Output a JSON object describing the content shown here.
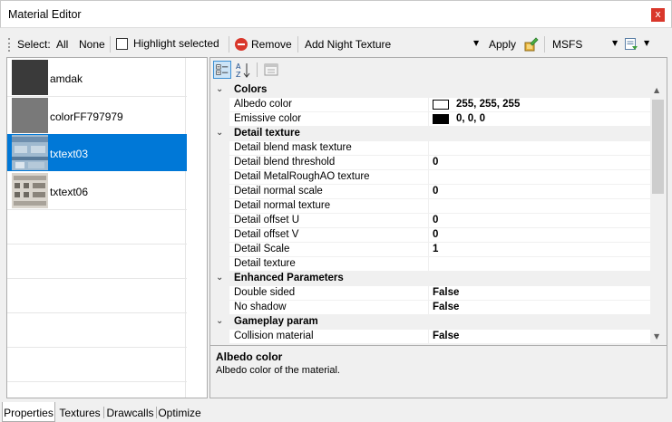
{
  "window": {
    "title": "Material Editor",
    "close_glyph": "x"
  },
  "toolbar": {
    "select_label": "Select:",
    "all_label": "All",
    "none_label": "None",
    "highlight_label": "Highlight selected",
    "highlight_checked": false,
    "remove_label": "Remove",
    "add_night_texture": "Add Night Texture",
    "apply_label": "Apply",
    "platform_value": "MSFS"
  },
  "materials": [
    {
      "name": "amdak",
      "selected": false
    },
    {
      "name": "colorFF797979",
      "selected": false
    },
    {
      "name": "txtext03",
      "selected": true
    },
    {
      "name": "txtext06",
      "selected": false
    }
  ],
  "properties": {
    "categories": [
      {
        "name": "Colors",
        "rows": [
          {
            "name": "Albedo color",
            "value": "255, 255, 255",
            "swatch": "#ffffff"
          },
          {
            "name": "Emissive color",
            "value": "0, 0, 0",
            "swatch": "#000000"
          }
        ]
      },
      {
        "name": "Detail texture",
        "rows": [
          {
            "name": "Detail blend mask texture",
            "value": ""
          },
          {
            "name": "Detail blend threshold",
            "value": "0"
          },
          {
            "name": "Detail MetalRoughAO texture",
            "value": ""
          },
          {
            "name": "Detail normal scale",
            "value": "0"
          },
          {
            "name": "Detail normal texture",
            "value": ""
          },
          {
            "name": "Detail offset U",
            "value": "0"
          },
          {
            "name": "Detail offset V",
            "value": "0"
          },
          {
            "name": "Detail Scale",
            "value": "1"
          },
          {
            "name": "Detail texture",
            "value": ""
          }
        ]
      },
      {
        "name": "Enhanced Parameters",
        "rows": [
          {
            "name": "Double sided",
            "value": "False"
          },
          {
            "name": "No shadow",
            "value": "False"
          }
        ]
      },
      {
        "name": "Gameplay param",
        "rows": [
          {
            "name": "Collision material",
            "value": "False"
          }
        ]
      }
    ],
    "description_title": "Albedo color",
    "description_text": "Albedo color of the material."
  },
  "tabs": [
    {
      "label": "Properties",
      "active": true
    },
    {
      "label": "Textures",
      "active": false
    },
    {
      "label": "Drawcalls",
      "active": false
    },
    {
      "label": "Optimize",
      "active": false
    }
  ],
  "icons": {
    "close": "close-icon",
    "remove": "remove-icon",
    "apply": "apply-icon",
    "export": "export-icon",
    "categorized": "categorized-icon",
    "alphabetical": "sort-alphabetical-icon",
    "property-pages": "property-pages-icon"
  },
  "colors": {
    "selection": "#0078d7",
    "close": "#d9372b"
  }
}
